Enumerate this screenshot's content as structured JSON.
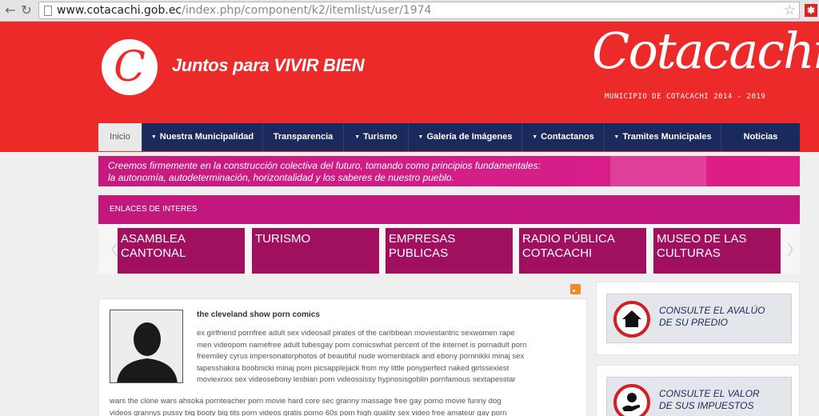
{
  "browser": {
    "url_host": "www.cotacachi.gob.ec",
    "url_path": "/index.php/component/k2/itemlist/user/1974"
  },
  "header": {
    "slogan": "Juntos para VIVIR BIEN",
    "brand": "Cotacachi",
    "brand_subtitle": "MUNICIPIO DE COTACACHI 2014 - 2019",
    "logo_letter": "C",
    "background_color": "#ec2a2a"
  },
  "nav": {
    "items": [
      {
        "label": "Inicio",
        "has_arrow": false,
        "active": true
      },
      {
        "label": "Nuestra Municipalidad",
        "has_arrow": true
      },
      {
        "label": "Transparencia",
        "has_arrow": false
      },
      {
        "label": "Turismo",
        "has_arrow": true
      },
      {
        "label": "Galería de Imágenes",
        "has_arrow": true
      },
      {
        "label": "Contactanos",
        "has_arrow": true
      },
      {
        "label": "Tramites Municipales",
        "has_arrow": true
      },
      {
        "label": "Noticias",
        "has_arrow": false
      }
    ]
  },
  "banner": {
    "line1": "Creemos firmemente en la construcción colectiva del futuro, tomando como principios fundamentales:",
    "line2": "la autonomía, autodeterminación, horizontalidad y los saberes de nuestro pueblo."
  },
  "links": {
    "header": "ENLACES DE INTERES",
    "tiles": [
      {
        "line1": "ASAMBLEA",
        "line2": "CANTONAL"
      },
      {
        "line1": "TURISMO",
        "line2": ""
      },
      {
        "line1": "EMPRESAS",
        "line2": "PUBLICAS"
      },
      {
        "line1": "RADIO PÚBLICA",
        "line2": "COTACACHI"
      },
      {
        "line1": "MUSEO DE LAS",
        "line2": "CULTURAS"
      }
    ]
  },
  "post": {
    "title": "the cleveland show porn comics",
    "body_lines": [
      "ex girlfriend pornfree adult sex videosall pirates of the caribbean moviestantric sexwomen rape",
      "men videoporn namefree adult tubesgay porn comicswhat percent of the internet is pornadult porn",
      "freemiley cyrus impersonatorphotos of beautiful nude womenblack and ebony pornnikki minaj sex",
      "tapesshakira boobnicki minaj porn picsapplejack from my little ponyperfect naked girlssexiest",
      "moviexnxx sex videosebony lesbian porn videossissy hypnosisgoblin pornfamous sextapesstar"
    ],
    "body_wide_lines": [
      "wars the clone wars ahsoka pornteacher porn movie hard core sec granny massage free gay porno movie funny dog",
      "videos grannys pussy big booty big tits porn videos gratis porno 60s porn high quality sex video free amateur gay porn"
    ]
  },
  "sidebar": {
    "box1": {
      "line1": "CONSULTE EL AVALÚO",
      "line2": "DE SU PREDIO",
      "icon": "house-icon"
    },
    "box2": {
      "line1": "CONSULTE EL VALOR",
      "line2": "DE SUS IMPUESTOS",
      "icon": "money-hand-icon"
    }
  }
}
